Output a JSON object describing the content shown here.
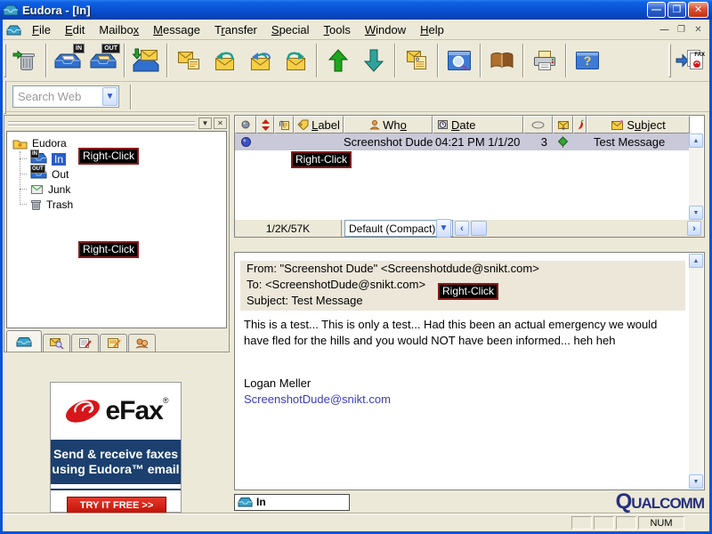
{
  "window": {
    "title": "Eudora - [In]"
  },
  "icons": {
    "help_glyph": "?",
    "in_badge": "IN",
    "out_badge": "OUT",
    "fax_badge": "FAX"
  },
  "menubar": {
    "items": [
      {
        "label": "File",
        "ul": 0
      },
      {
        "label": "Edit",
        "ul": 0
      },
      {
        "label": "Mailbox",
        "ul": 6
      },
      {
        "label": "Message",
        "ul": 0
      },
      {
        "label": "Transfer",
        "ul": 1
      },
      {
        "label": "Special",
        "ul": 0
      },
      {
        "label": "Tools",
        "ul": 0
      },
      {
        "label": "Window",
        "ul": 0
      },
      {
        "label": "Help",
        "ul": 0
      }
    ]
  },
  "search_toolbar": {
    "value": "Search Web"
  },
  "mailbox_pane": {
    "root": "Eudora",
    "items": [
      {
        "label": "In",
        "selected": true
      },
      {
        "label": "Out",
        "selected": false
      },
      {
        "label": "Junk",
        "selected": false
      },
      {
        "label": "Trash",
        "selected": false
      }
    ]
  },
  "annotation": {
    "right_click": "Right-Click"
  },
  "message_list": {
    "columns": {
      "label": {
        "label": "Label",
        "ul": 0
      },
      "who": {
        "label": "Who",
        "ul": 2
      },
      "date": {
        "label": "Date",
        "ul": 0
      },
      "subject": {
        "label": "Subject",
        "ul": 1
      }
    },
    "row": {
      "who": "Screenshot Dude",
      "date": "04:21 PM 1/1/20",
      "size": "3",
      "subject": "Test Message"
    },
    "footer": {
      "counts": "1/2K/57K",
      "view": "Default (Compact)"
    }
  },
  "preview": {
    "from_line": "From: \"Screenshot Dude\" <Screenshotdude@snikt.com>",
    "to_line": "To: <ScreenshotDude@snikt.com>",
    "subject_line": "Subject: Test Message",
    "body": "This is a test... This is only a test... Had this been an actual emergency we would have fled for the hills and you would NOT have been informed... heh heh",
    "signature_name": "Logan Meller",
    "signature_email": "ScreenshotDude@snikt.com"
  },
  "ad": {
    "brand": "eFax",
    "reg": "®",
    "line1": "Send & receive faxes",
    "line2": "using Eudora™ email",
    "cta": "TRY IT FREE >>"
  },
  "taskbar": {
    "mailbox_tab": "In",
    "brand": "QUALCOMM"
  },
  "statusbar": {
    "num": "NUM"
  },
  "colors": {
    "titlebar_blue": "#0A53D8",
    "selection_row": "#C9C9D9",
    "link": "#3B3BC4",
    "ad_navy": "#1B3F6E",
    "ad_red": "#C21408",
    "annotation_border": "#8B1A1A",
    "chrome_beige": "#ECE9D8"
  }
}
